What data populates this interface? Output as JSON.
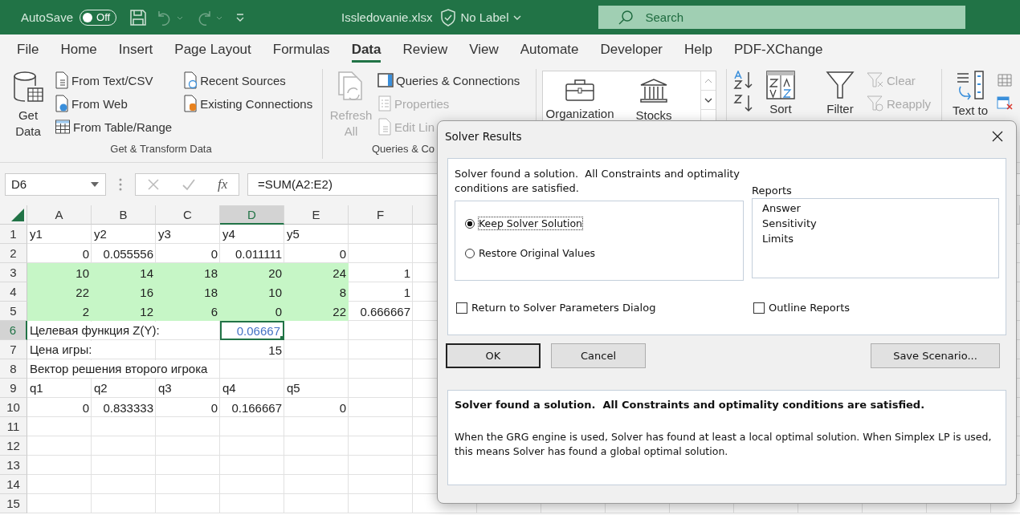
{
  "title_bar": {
    "autosave": {
      "label": "AutoSave",
      "state": "Off",
      "on": false
    },
    "quick_access": [
      {
        "kind": "save",
        "disabled": false
      },
      {
        "kind": "undo",
        "disabled": true
      },
      {
        "kind": "redo",
        "disabled": true
      },
      {
        "kind": "customize",
        "disabled": false
      }
    ],
    "file_name": "Issledovanie.xlsx",
    "sensitivity": "No Label",
    "search": {
      "placeholder": "Search"
    }
  },
  "tabs": [
    {
      "label": "File",
      "selected": false
    },
    {
      "label": "Home",
      "selected": false
    },
    {
      "label": "Insert",
      "selected": false
    },
    {
      "label": "Page Layout",
      "selected": false
    },
    {
      "label": "Formulas",
      "selected": false
    },
    {
      "label": "Data",
      "selected": true
    },
    {
      "label": "Review",
      "selected": false
    },
    {
      "label": "View",
      "selected": false
    },
    {
      "label": "Automate",
      "selected": false
    },
    {
      "label": "Developer",
      "selected": false
    },
    {
      "label": "Help",
      "selected": false
    },
    {
      "label": "PDF-XChange",
      "selected": false
    }
  ],
  "ribbon": {
    "groups": [
      {
        "label": "Get & Transform Data",
        "kind": "commands",
        "items": [
          {
            "label": "Get Data",
            "kind": "large",
            "disabled": false
          },
          {
            "label": "From Text/CSV",
            "kind": "small",
            "disabled": false
          },
          {
            "label": "From Web",
            "kind": "small",
            "disabled": false
          },
          {
            "label": "From Table/Range",
            "kind": "small",
            "disabled": false
          },
          {
            "label": "Recent Sources",
            "kind": "small",
            "disabled": false
          },
          {
            "label": "Existing Connections",
            "kind": "small",
            "disabled": false
          }
        ]
      },
      {
        "label": "Queries & Co",
        "kind": "commands",
        "items": [
          {
            "label": "Refresh All",
            "kind": "large",
            "disabled": true
          },
          {
            "label": "Queries & Connections",
            "kind": "small",
            "disabled": false
          },
          {
            "label": "Properties",
            "kind": "small",
            "disabled": true
          },
          {
            "label": "Edit Lin",
            "kind": "small",
            "disabled": true
          }
        ]
      },
      {
        "kind": "gallery",
        "items": [
          {
            "label": "Organization",
            "kind": "large",
            "disabled": false
          },
          {
            "label": "Stocks",
            "kind": "large",
            "disabled": false
          }
        ]
      },
      {
        "kind": "commands",
        "items": [
          {
            "kind": "icon",
            "disabled": false
          },
          {
            "kind": "icon",
            "disabled": false
          },
          {
            "label": "Sort",
            "kind": "large",
            "disabled": false
          },
          {
            "label": "Filter",
            "kind": "large",
            "disabled": false
          },
          {
            "label": "Clear",
            "kind": "small",
            "disabled": true
          },
          {
            "label": "Reapply",
            "kind": "small",
            "disabled": true
          }
        ]
      },
      {
        "kind": "commands",
        "items": [
          {
            "label": "Text to",
            "kind": "large",
            "disabled": false
          },
          {
            "kind": "icon",
            "disabled": false
          },
          {
            "kind": "icon",
            "disabled": false
          }
        ]
      }
    ]
  },
  "sheet": {
    "name_box": "D6",
    "function_button": "fx",
    "formula": "=SUM(A2:E2)",
    "columns": [
      {
        "label": "A",
        "selected": false
      },
      {
        "label": "B",
        "selected": false
      },
      {
        "label": "C",
        "selected": false
      },
      {
        "label": "D",
        "selected": true
      },
      {
        "label": "E",
        "selected": false
      },
      {
        "label": "F",
        "selected": false
      }
    ],
    "rows": [
      {
        "number": "1",
        "selected": false,
        "cells": [
          {
            "value": "y1",
            "kind": "text",
            "highlighted": false,
            "selected": false
          },
          {
            "value": "y2",
            "kind": "text",
            "highlighted": false,
            "selected": false
          },
          {
            "value": "y3",
            "kind": "text",
            "highlighted": false,
            "selected": false
          },
          {
            "value": "y4",
            "kind": "text",
            "highlighted": false,
            "selected": false
          },
          {
            "value": "y5",
            "kind": "text",
            "highlighted": false,
            "selected": false
          }
        ]
      },
      {
        "number": "2",
        "selected": false,
        "cells": [
          {
            "value": "0",
            "kind": "number",
            "highlighted": false,
            "selected": false
          },
          {
            "value": "0.055556",
            "kind": "number",
            "highlighted": false,
            "selected": false
          },
          {
            "value": "0",
            "kind": "number",
            "highlighted": false,
            "selected": false
          },
          {
            "value": "0.011111",
            "kind": "number",
            "highlighted": false,
            "selected": false
          },
          {
            "value": "0",
            "kind": "number",
            "highlighted": false,
            "selected": false
          }
        ]
      },
      {
        "number": "3",
        "selected": false,
        "cells": [
          {
            "value": "10",
            "kind": "number",
            "highlighted": true,
            "selected": false
          },
          {
            "value": "14",
            "kind": "number",
            "highlighted": true,
            "selected": false
          },
          {
            "value": "18",
            "kind": "number",
            "highlighted": true,
            "selected": false
          },
          {
            "value": "20",
            "kind": "number",
            "highlighted": true,
            "selected": false
          },
          {
            "value": "24",
            "kind": "number",
            "highlighted": true,
            "selected": false
          },
          {
            "value": "1",
            "kind": "number",
            "highlighted": false,
            "selected": false
          }
        ]
      },
      {
        "number": "4",
        "selected": false,
        "cells": [
          {
            "value": "22",
            "kind": "number",
            "highlighted": true,
            "selected": false
          },
          {
            "value": "16",
            "kind": "number",
            "highlighted": true,
            "selected": false
          },
          {
            "value": "18",
            "kind": "number",
            "highlighted": true,
            "selected": false
          },
          {
            "value": "10",
            "kind": "number",
            "highlighted": true,
            "selected": false
          },
          {
            "value": "8",
            "kind": "number",
            "highlighted": true,
            "selected": false
          },
          {
            "value": "1",
            "kind": "number",
            "highlighted": false,
            "selected": false
          }
        ]
      },
      {
        "number": "5",
        "selected": false,
        "cells": [
          {
            "value": "2",
            "kind": "number",
            "highlighted": true,
            "selected": false
          },
          {
            "value": "12",
            "kind": "number",
            "highlighted": true,
            "selected": false
          },
          {
            "value": "6",
            "kind": "number",
            "highlighted": true,
            "selected": false
          },
          {
            "value": "0",
            "kind": "number",
            "highlighted": true,
            "selected": false
          },
          {
            "value": "22",
            "kind": "number",
            "highlighted": true,
            "selected": false
          },
          {
            "value": "0.666667",
            "kind": "number",
            "highlighted": false,
            "selected": false
          }
        ]
      },
      {
        "number": "6",
        "selected": true,
        "cells": [
          {
            "value": "Целевая функция Z(Y):",
            "kind": "text",
            "highlighted": false,
            "selected": false
          },
          null,
          null,
          {
            "value": "0.06667",
            "kind": "number",
            "highlighted": false,
            "selected": true,
            "color": "#4472c4"
          }
        ]
      },
      {
        "number": "7",
        "selected": false,
        "cells": [
          {
            "value": "Цена игры:",
            "kind": "text",
            "highlighted": false,
            "selected": false
          },
          null,
          null,
          {
            "value": "15",
            "kind": "number",
            "highlighted": false,
            "selected": false
          }
        ]
      },
      {
        "number": "8",
        "selected": false,
        "cells": [
          {
            "value": "Вектор решения второго игрока",
            "kind": "text",
            "highlighted": false,
            "selected": false
          }
        ]
      },
      {
        "number": "9",
        "selected": false,
        "cells": [
          {
            "value": "q1",
            "kind": "text",
            "highlighted": false,
            "selected": false
          },
          {
            "value": "q2",
            "kind": "text",
            "highlighted": false,
            "selected": false
          },
          {
            "value": "q3",
            "kind": "text",
            "highlighted": false,
            "selected": false
          },
          {
            "value": "q4",
            "kind": "text",
            "highlighted": false,
            "selected": false
          },
          {
            "value": "q5",
            "kind": "text",
            "highlighted": false,
            "selected": false
          }
        ]
      },
      {
        "number": "10",
        "selected": false,
        "cells": [
          {
            "value": "0",
            "kind": "number",
            "highlighted": false,
            "selected": false
          },
          {
            "value": "0.833333",
            "kind": "number",
            "highlighted": false,
            "selected": false
          },
          {
            "value": "0",
            "kind": "number",
            "highlighted": false,
            "selected": false
          },
          {
            "value": "0.166667",
            "kind": "number",
            "highlighted": false,
            "selected": false
          },
          {
            "value": "0",
            "kind": "number",
            "highlighted": false,
            "selected": false
          }
        ]
      },
      {
        "number": "11",
        "selected": false
      },
      {
        "number": "12",
        "selected": false
      },
      {
        "number": "13",
        "selected": false
      },
      {
        "number": "14",
        "selected": false
      },
      {
        "number": "15",
        "selected": false
      }
    ]
  },
  "dialog": {
    "title": "Solver Results",
    "message": "Solver found a solution.  All Constraints and optimality conditions are satisfied.",
    "options": [
      {
        "label": "Keep Solver Solution",
        "selected": true,
        "focused": true
      },
      {
        "label": "Restore Original Values",
        "selected": false,
        "focused": false
      }
    ],
    "reports": {
      "label": "Reports",
      "items": [
        {
          "label": "Answer",
          "selected": false
        },
        {
          "label": "Sensitivity",
          "selected": false
        },
        {
          "label": "Limits",
          "selected": false
        }
      ]
    },
    "checkboxes": [
      {
        "label": "Return to Solver Parameters Dialog",
        "checked": false
      },
      {
        "label": "Outline Reports",
        "checked": false
      }
    ],
    "buttons": [
      {
        "label": "OK",
        "default": true
      },
      {
        "label": "Cancel",
        "default": false
      },
      {
        "label": "Save Scenario...",
        "default": false
      }
    ],
    "details": {
      "heading": "Solver found a solution.  All Constraints and optimality conditions are satisfied.",
      "text": "When the GRG engine is used, Solver has found at least a local optimal solution. When Simplex LP is used, this means Solver has found a global optimal solution."
    }
  }
}
